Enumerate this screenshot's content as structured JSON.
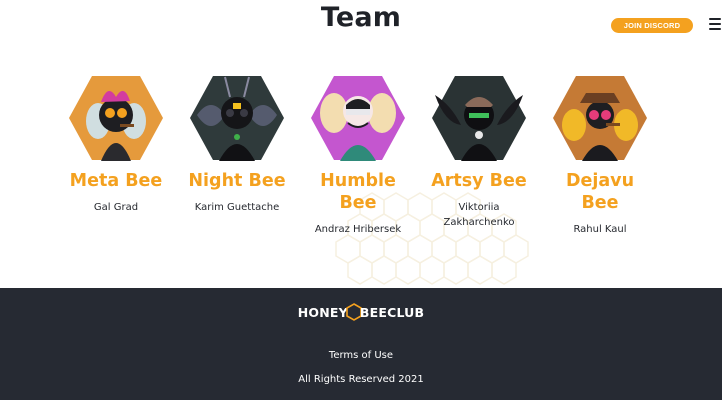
{
  "section": {
    "title": "Team"
  },
  "header": {
    "discord_label": "JOIN DISCORD"
  },
  "members": [
    {
      "name": "Meta Bee",
      "person": "Gal Grad",
      "bg": "#e59a3c"
    },
    {
      "name": "Night Bee",
      "person": "Karim Guettache",
      "bg": "#2f3a3b"
    },
    {
      "name": "Humble Bee",
      "person": "Andraz Hribersek",
      "bg": "#c456cf"
    },
    {
      "name": "Artsy Bee",
      "person": "Viktoriia Zakharchenko",
      "bg": "#2a3334"
    },
    {
      "name": "Dejavu Bee",
      "person": "Rahul Kaul",
      "bg": "#c57a35"
    }
  ],
  "footer": {
    "logo_left": "HONEY",
    "logo_right": "BEECLUB",
    "terms": "Terms of Use",
    "rights": "All Rights Reserved 2021"
  },
  "colors": {
    "accent": "#f4a11f",
    "footer_bg": "#262a33",
    "text": "#1f2228"
  }
}
